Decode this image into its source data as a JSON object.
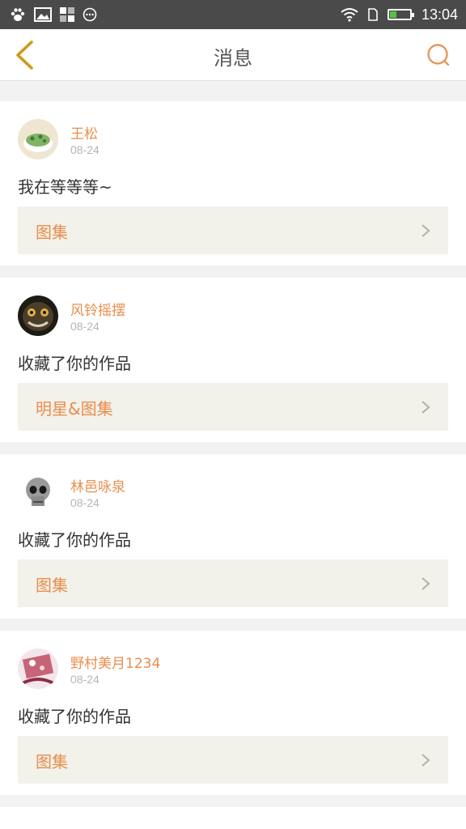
{
  "status_bar": {
    "time": "13:04",
    "left_icons": [
      "paw-icon",
      "image-icon",
      "grid-icon",
      "dots-circle-icon"
    ],
    "right_icons": [
      "wifi-icon",
      "sim-icon",
      "battery-icon"
    ],
    "battery_level": 0.35
  },
  "header": {
    "title": "消息",
    "back_icon": "chevron-left-icon",
    "search_icon": "search-icon"
  },
  "colors": {
    "accent": "#e98e4d",
    "back_icon": "#e8b12e",
    "album_bg": "#f2f1ea",
    "page_bg": "#f2f2f2"
  },
  "messages": [
    {
      "user": "王松",
      "date": "08-24",
      "text": "我在等等等~",
      "album": "图集",
      "avatar": "cake-avatar"
    },
    {
      "user": "风铃摇摆",
      "date": "08-24",
      "text": "收藏了你的作品",
      "album": "明星&图集",
      "avatar": "monster-avatar"
    },
    {
      "user": "林邑咏泉",
      "date": "08-24",
      "text": "收藏了你的作品",
      "album": "图集",
      "avatar": "skull-avatar"
    },
    {
      "user": "野村美月1234",
      "date": "08-24",
      "text": "收藏了你的作品",
      "album": "图集",
      "avatar": "floral-avatar"
    }
  ]
}
